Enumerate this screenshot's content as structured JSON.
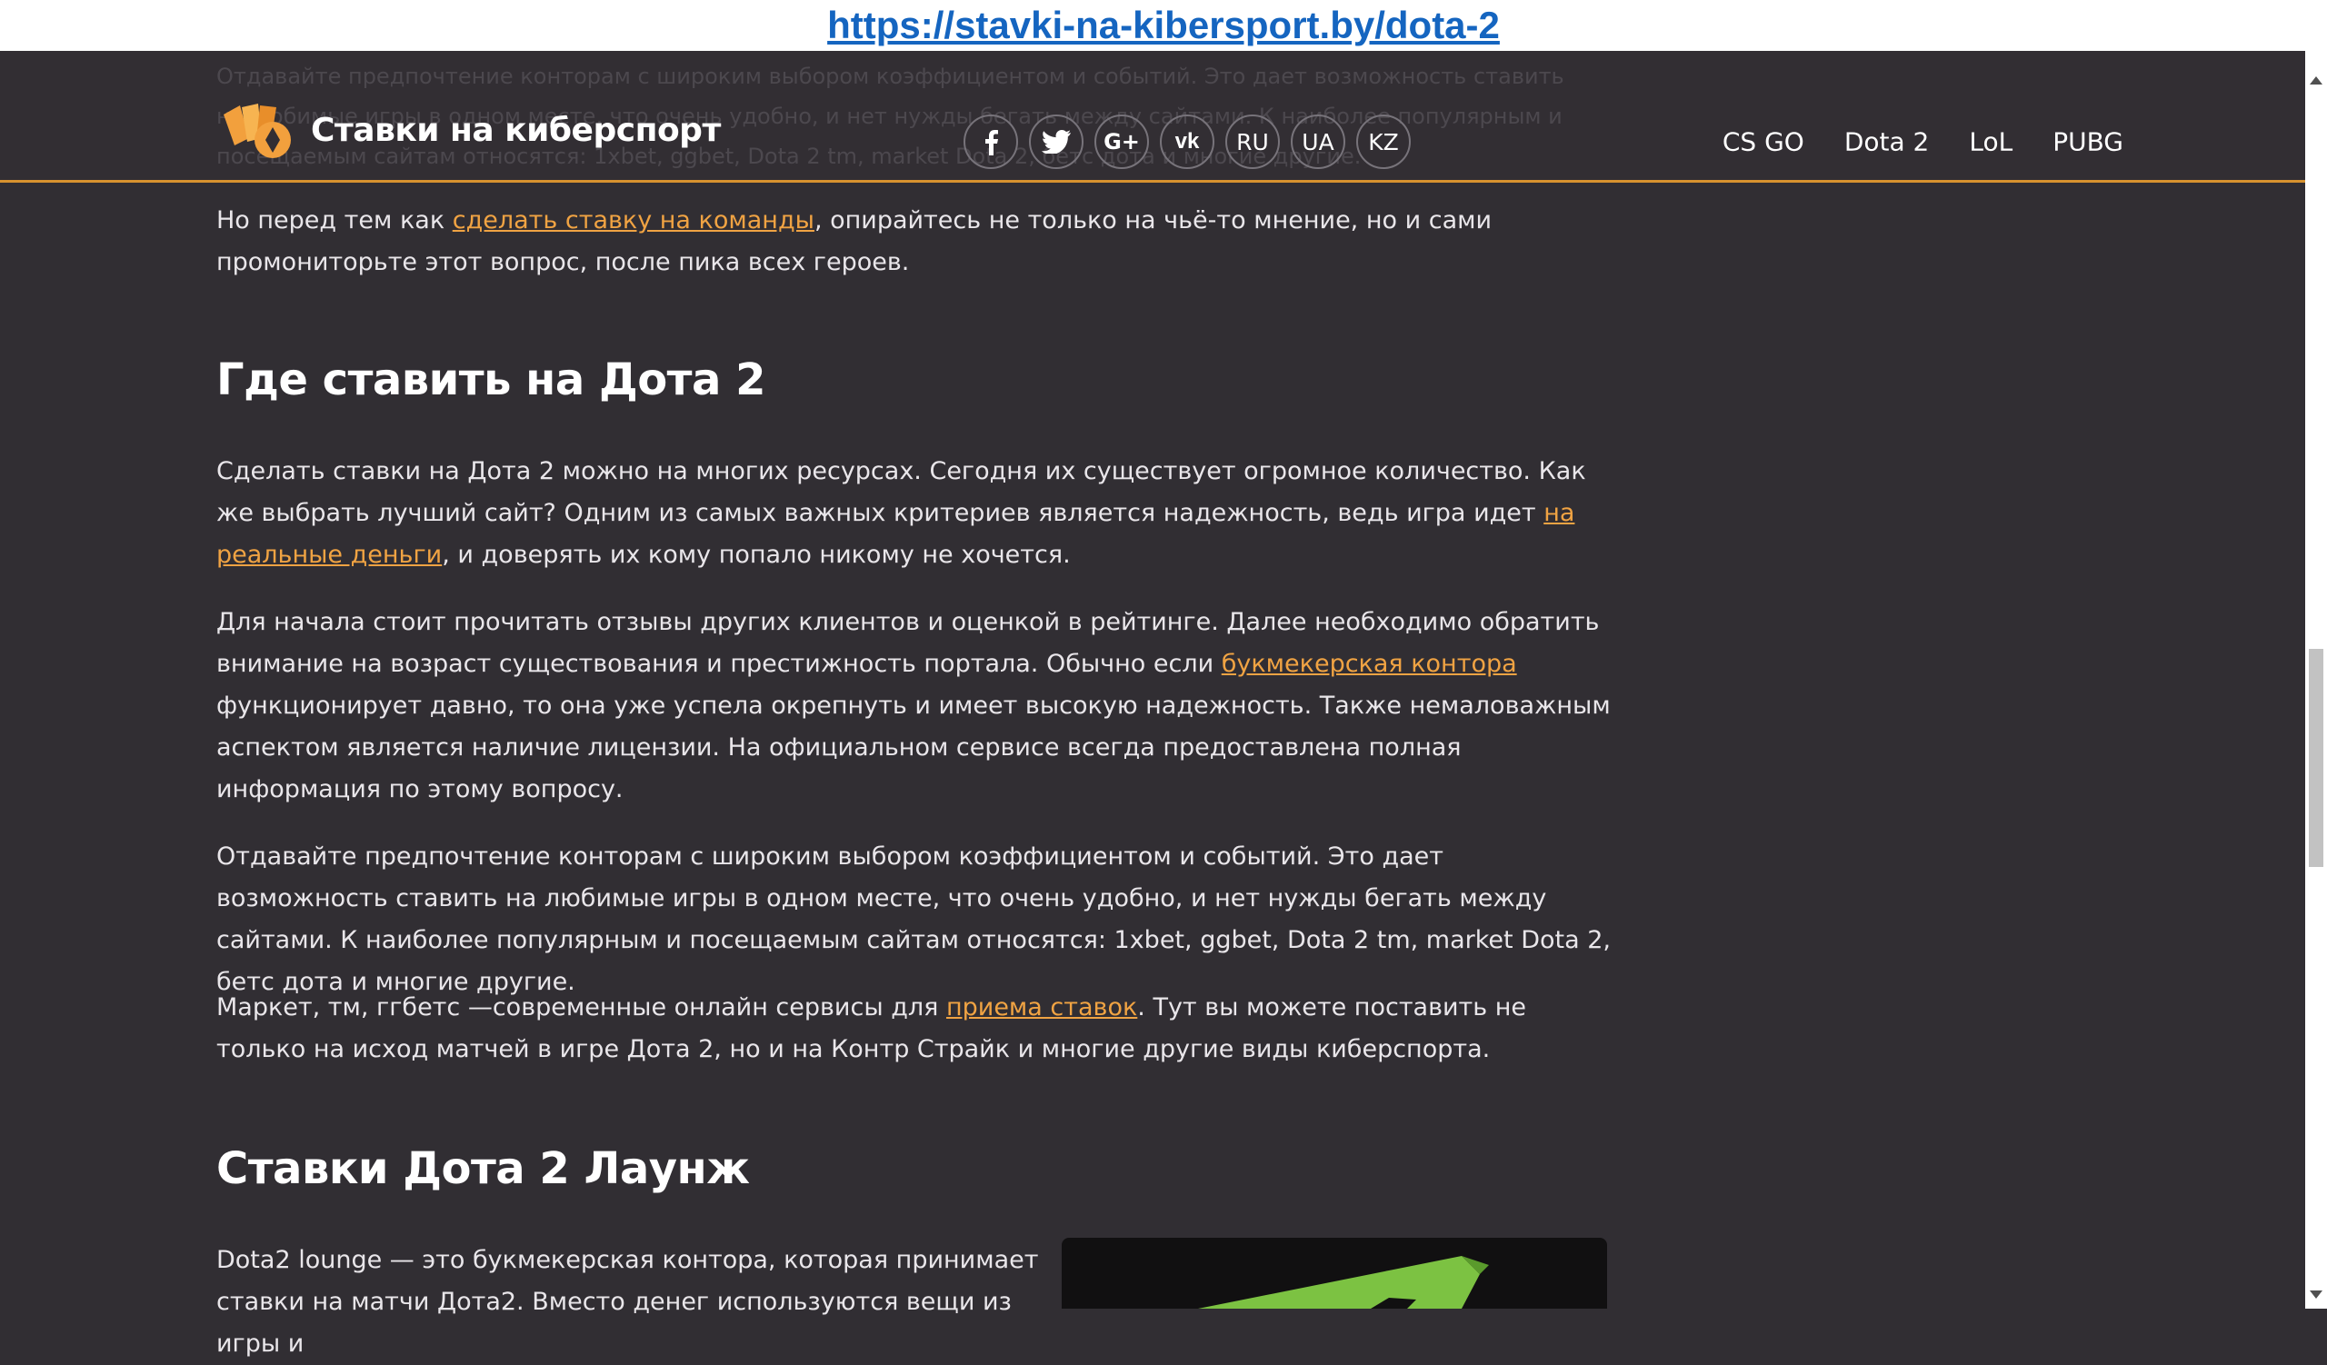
{
  "url": "https://stavki-na-kibersport.by/dota-2",
  "header": {
    "site_name": "Ставки на киберспорт",
    "social": [
      {
        "icon": "facebook-icon",
        "glyph": "f"
      },
      {
        "icon": "twitter-icon",
        "glyph": "🐦"
      },
      {
        "icon": "google-plus-icon",
        "glyph": "G+"
      },
      {
        "icon": "vk-icon",
        "glyph": "vk"
      }
    ],
    "langs": [
      "RU",
      "UA",
      "KZ"
    ],
    "nav": [
      "CS GO",
      "Dota 2",
      "LoL",
      "PUBG"
    ]
  },
  "article": {
    "p1": {
      "before": "Но перед тем как ",
      "link": "сделать ставку на команды",
      "after": ", опирайтесь не только на чьё-то мнение, но и сами промониторьте этот вопрос, после пика всех героев."
    },
    "h_where": "Где ставить на Дота 2",
    "p2": {
      "before": "Сделать ставки на Дота 2 можно на многих ресурсах. Сегодня их существует огромное количество. Как же выбрать лучший сайт? Одним из самых важных критериев является надежность, ведь игра идет ",
      "link": "на реальные деньги",
      "after": ", и доверять их кому попало никому не хочется."
    },
    "p3": {
      "before": "Для начала стоит прочитать отзывы других клиентов и оценкой в рейтинге. Далее необходимо обратить внимание на возраст существования и престижность портала. Обычно если ",
      "link": "букмекерская контора",
      "after": " функционирует давно, то она уже успела окрепнуть и имеет высокую надежность. Также немаловажным аспектом является наличие лицензии. На официальном сервисе всегда предоставлена полная информация по этому вопросу."
    },
    "p4": "Отдавайте предпочтение конторам с широким выбором коэффициентом и событий. Это дает возможность ставить на любимые игры в одном месте, что очень удобно, и нет нужды бегать между сайтами. К наиболее популярным и посещаемым сайтам относятся: 1xbet, ggbet, Dota 2 tm, market Dota 2, бетс дота и многие другие.",
    "p5": {
      "before": "Маркет, тм, ггбетс —современные онлайн сервисы для ",
      "link": "приема ставок",
      "after": ". Тут вы можете поставить не только на исход матчей в игре Дота 2, но и на Контр Страйк и многие другие виды киберспорта."
    },
    "h_lounge": "Ставки Дота 2 Лаунж",
    "p6": "Dota2 lounge — это букмекерская контора, которая принимает ставки на матчи Дота2. Вместо денег используются вещи из игры и"
  },
  "colors": {
    "background": "#312e33",
    "accent": "#d7922f",
    "link": "#f0a343",
    "promo_green": "#7cc242"
  }
}
